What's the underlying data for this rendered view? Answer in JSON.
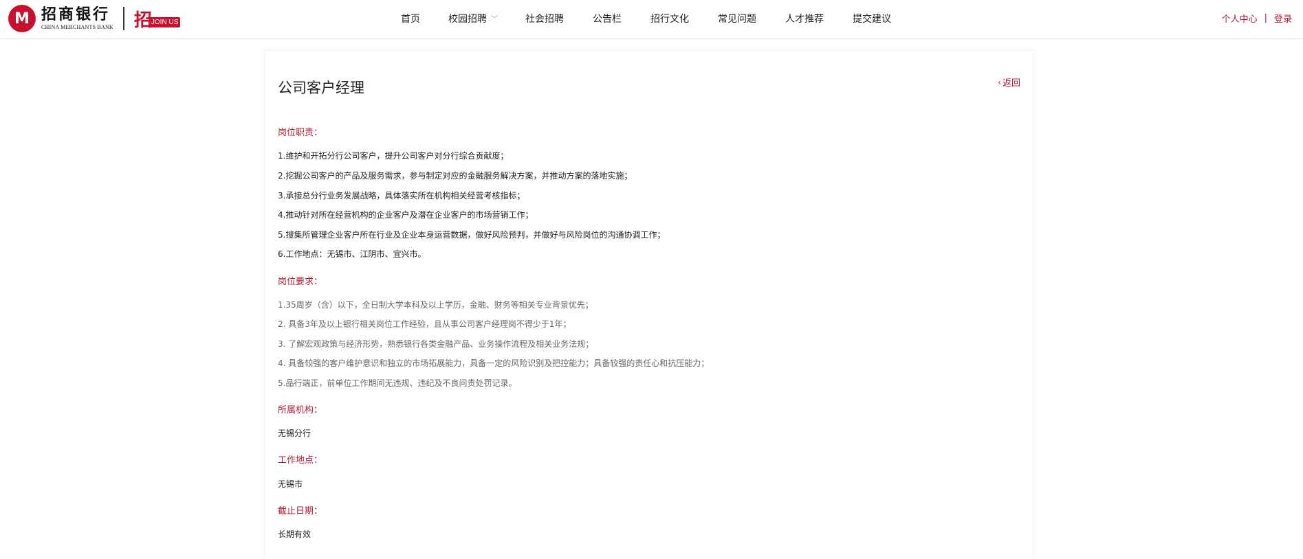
{
  "header": {
    "logo_glyph": "M",
    "logo_cn": "招商银行",
    "logo_en": "CHINA MERCHANTS BANK",
    "joinus_char": "招",
    "joinus_badge": "JOIN US",
    "nav": [
      {
        "label": "首页"
      },
      {
        "label": "校园招聘",
        "has_dropdown": true
      },
      {
        "label": "社会招聘"
      },
      {
        "label": "公告栏"
      },
      {
        "label": "招行文化"
      },
      {
        "label": "常见问题"
      },
      {
        "label": "人才推荐"
      },
      {
        "label": "提交建议"
      }
    ],
    "user_center": "个人中心",
    "separator": "|",
    "login": "登录"
  },
  "job": {
    "title": "公司客户经理",
    "back_label": "返回",
    "duties_label": "岗位职责：",
    "duties": [
      "1.维护和开拓分行公司客户，提升公司客户对分行综合贡献度；",
      "2.挖掘公司客户的产品及服务需求，参与制定对应的金融服务解决方案，并推动方案的落地实施；",
      "3.承接总分行业务发展战略，具体落实所在机构相关经营考核指标；",
      "4.推动针对所在经营机构的企业客户及潜在企业客户的市场营销工作；",
      "5.搜集所管理企业客户所在行业及企业本身运营数据，做好风险预判，并做好与风险岗位的沟通协调工作；",
      "6.工作地点：无锡市、江阴市、宜兴市。"
    ],
    "requirements_label": "岗位要求：",
    "requirements": [
      "1.35周岁（含）以下，全日制大学本科及以上学历，金融、财务等相关专业背景优先；",
      "2. 具备3年及以上银行相关岗位工作经验，且从事公司客户经理岗不得少于1年；",
      "3. 了解宏观政策与经济形势，熟悉银行各类金融产品、业务操作流程及相关业务法规；",
      "4. 具备较强的客户维护意识和独立的市场拓展能力，具备一定的风险识别及把控能力；具备较强的责任心和抗压能力；",
      "5.品行端正，前单位工作期间无违规、违纪及不良问责处罚记录。"
    ],
    "org_label": "所属机构：",
    "org_value": "无锡分行",
    "location_label": "工作地点：",
    "location_value": "无锡市",
    "deadline_label": "截止日期：",
    "deadline_value": "长期有效"
  },
  "colors": {
    "brand_red": "#c8102e",
    "link_red": "#b31b34"
  },
  "icons": {
    "back": "chevron-left-icon",
    "dropdown": "chevron-down-icon"
  }
}
